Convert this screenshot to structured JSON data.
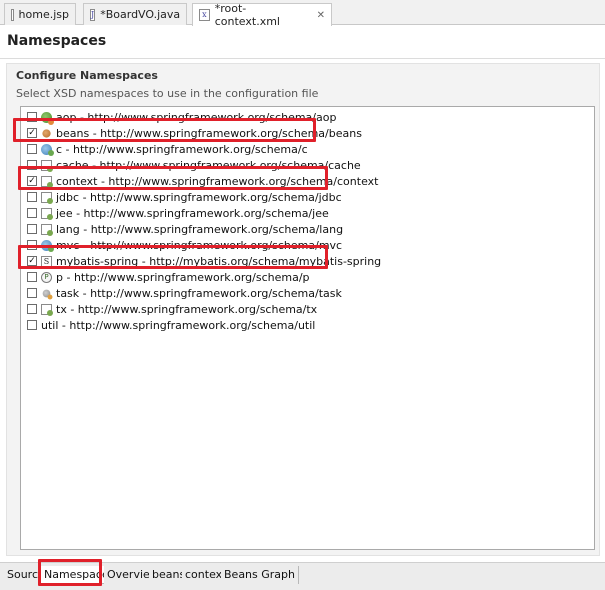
{
  "editor_tabs": [
    {
      "label": "home.jsp",
      "active": false
    },
    {
      "label": "*BoardVO.java",
      "active": false
    },
    {
      "label": "*root-context.xml",
      "active": true
    }
  ],
  "page_title": "Namespaces",
  "section": {
    "title": "Configure Namespaces",
    "description": "Select XSD namespaces to use in the configuration file"
  },
  "namespaces": [
    {
      "label": "aop - http://www.springframework.org/schema/aop",
      "checked": false,
      "icon": "spring-leaf-icon"
    },
    {
      "label": "beans - http://www.springframework.org/schema/beans",
      "checked": true,
      "icon": "bean-icon"
    },
    {
      "label": "c - http://www.springframework.org/schema/c",
      "checked": false,
      "icon": "globe-icon"
    },
    {
      "label": "cache - http://www.springframework.org/schema/cache",
      "checked": false,
      "icon": "cache-icon"
    },
    {
      "label": "context - http://www.springframework.org/schema/context",
      "checked": true,
      "icon": "context-icon"
    },
    {
      "label": "jdbc - http://www.springframework.org/schema/jdbc",
      "checked": false,
      "icon": "page-icon"
    },
    {
      "label": "jee - http://www.springframework.org/schema/jee",
      "checked": false,
      "icon": "page-icon"
    },
    {
      "label": "lang - http://www.springframework.org/schema/lang",
      "checked": false,
      "icon": "page-icon"
    },
    {
      "label": "mvc - http://www.springframework.org/schema/mvc",
      "checked": false,
      "icon": "globe-icon"
    },
    {
      "label": "mybatis-spring - http://mybatis.org/schema/mybatis-spring",
      "checked": true,
      "icon": "s-file-icon"
    },
    {
      "label": "p - http://www.springframework.org/schema/p",
      "checked": false,
      "icon": "p-icon"
    },
    {
      "label": "task - http://www.springframework.org/schema/task",
      "checked": false,
      "icon": "task-icon"
    },
    {
      "label": "tx - http://www.springframework.org/schema/tx",
      "checked": false,
      "icon": "page-icon"
    },
    {
      "label": "util - http://www.springframework.org/schema/util",
      "checked": false,
      "icon": "none"
    }
  ],
  "bottom_tabs": [
    {
      "label": "Source",
      "active": false
    },
    {
      "label": "Namespaces",
      "active": true
    },
    {
      "label": "Overview",
      "active": false
    },
    {
      "label": "beans",
      "active": false
    },
    {
      "label": "context",
      "active": false
    },
    {
      "label": "Beans Graph",
      "active": false
    }
  ],
  "colors": {
    "highlight": "#e0202a",
    "accent": "#3a6ea5"
  }
}
